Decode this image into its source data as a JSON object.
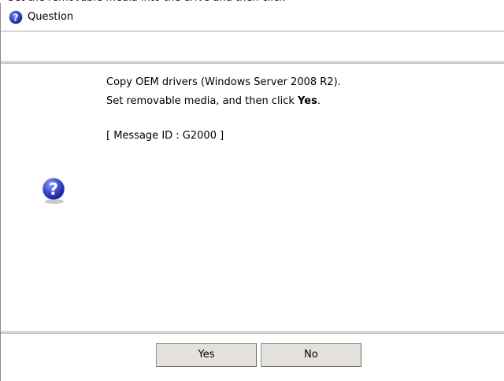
{
  "dialog": {
    "title": "Question",
    "icon": "question-icon"
  },
  "message": {
    "line1": "Copy OEM drivers (Windows Server 2008 R2).",
    "line2_prefix": "Set removable media, and then click ",
    "line2_bold": "Yes",
    "line2_suffix": ".",
    "message_id": "[ Message ID : G2000 ]"
  },
  "buttons": {
    "yes": "Yes",
    "no": "No"
  },
  "colors": {
    "icon_blue": "#2f3fb5",
    "button_face": "#e4e1dc",
    "separator": "#d4d4d4"
  }
}
